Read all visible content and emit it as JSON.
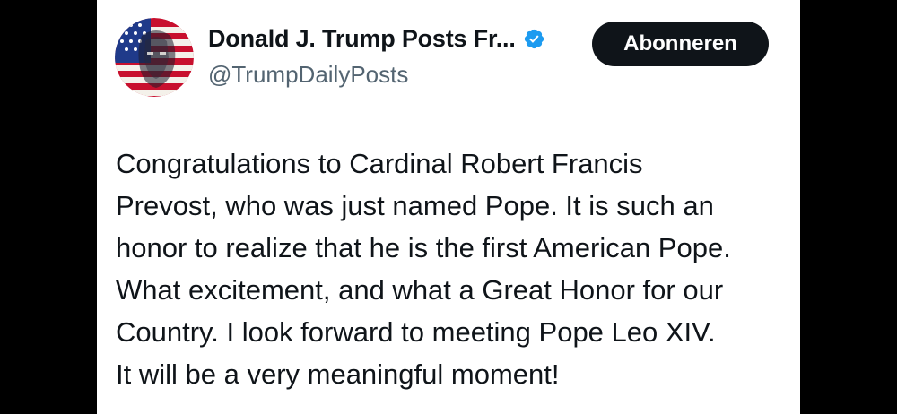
{
  "post": {
    "author": {
      "display_name": "Donald J. Trump Posts Fr...",
      "handle": "@TrumpDailyPosts",
      "verified": true,
      "verified_icon": "verified-badge-icon",
      "verified_color": "#1d9bf0",
      "avatar": "avatar"
    },
    "follow_button": {
      "label": "Abonneren",
      "background": "#0f1419",
      "text_color": "#ffffff"
    },
    "text_lines": [
      "Congratulations to Cardinal Robert Francis",
      "Prevost, who was just named Pope. It is such an",
      "honor to realize that he is the first American Pope.",
      "What excitement, and what a Great Honor for our",
      "Country. I look forward to meeting Pope Leo XIV.",
      "It will be a very meaningful moment!"
    ]
  },
  "colors": {
    "text_primary": "#0f1419",
    "text_secondary": "#536471",
    "card_background": "#ffffff",
    "outer_background": "#000000"
  }
}
